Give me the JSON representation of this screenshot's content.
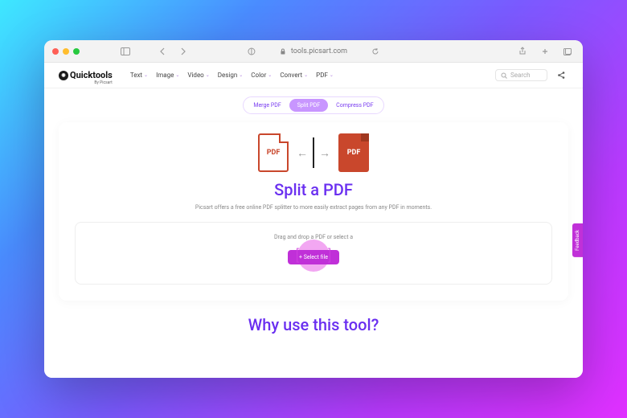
{
  "browser": {
    "url": "tools.picsart.com"
  },
  "header": {
    "logo_main": "Quicktools",
    "logo_sub": "By Picsart",
    "nav": [
      {
        "label": "Text"
      },
      {
        "label": "Image"
      },
      {
        "label": "Video"
      },
      {
        "label": "Design"
      },
      {
        "label": "Color"
      },
      {
        "label": "Convert"
      },
      {
        "label": "PDF"
      }
    ],
    "search_placeholder": "Search"
  },
  "tabs": [
    {
      "label": "Merge PDF",
      "active": false
    },
    {
      "label": "Split PDF",
      "active": true
    },
    {
      "label": "Compress PDF",
      "active": false
    }
  ],
  "illustration": {
    "left_label": "PDF",
    "right_label": "PDF"
  },
  "main": {
    "title": "Split a PDF",
    "subtitle": "Picsart offers a free online PDF splitter to more easily extract pages from any PDF in moments.",
    "dropzone_text": "Drag and drop a PDF or select a",
    "select_button": "+  Select file"
  },
  "why_title": "Why use this tool?",
  "feedback_label": "Feedback"
}
